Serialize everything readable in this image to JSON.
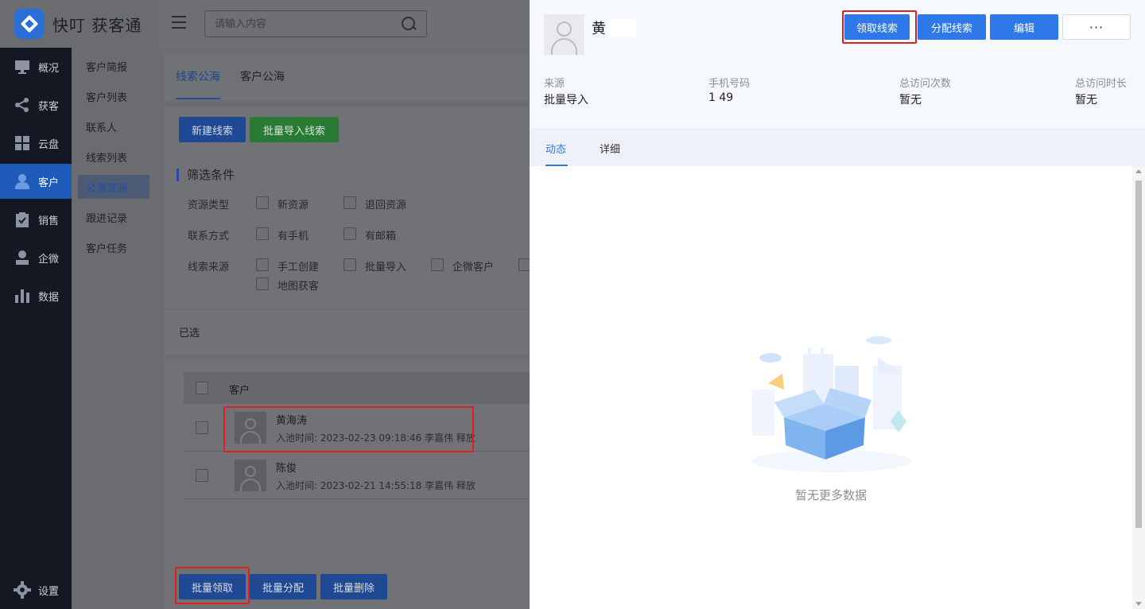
{
  "app": {
    "name": "快叮 获客通",
    "brand_color": "#2e78ea",
    "search": {
      "placeholder": "请输入内容"
    }
  },
  "nav": {
    "items": [
      {
        "label": "概况",
        "icon": "monitor-icon"
      },
      {
        "label": "获客",
        "icon": "share-icon"
      },
      {
        "label": "云盘",
        "icon": "grid-icon"
      },
      {
        "label": "客户",
        "icon": "user-icon",
        "active": true
      },
      {
        "label": "销售",
        "icon": "clipboard-check-icon"
      },
      {
        "label": "企微",
        "icon": "person-icon"
      },
      {
        "label": "数据",
        "icon": "bar-chart-icon"
      }
    ],
    "settings": {
      "label": "设置",
      "icon": "gear-icon"
    }
  },
  "submenu": {
    "items": [
      "客户简报",
      "客户列表",
      "联系人",
      "线索列表",
      "公海资源",
      "跟进记录",
      "客户任务"
    ],
    "active_index": 4
  },
  "main": {
    "tabs": [
      "线索公海",
      "客户公海"
    ],
    "toolbar": {
      "new_lead": "新建线索",
      "batch_import": "批量导入线索"
    },
    "filters": {
      "title": "筛选条件",
      "rows": [
        {
          "label": "资源类型",
          "options": [
            "新资源",
            "退回资源"
          ]
        },
        {
          "label": "联系方式",
          "options": [
            "有手机",
            "有邮箱"
          ]
        },
        {
          "label": "线索来源",
          "options": [
            "手工创建",
            "批量导入",
            "企微客户",
            "地图获客"
          ]
        }
      ]
    },
    "selected_label": "已选",
    "table": {
      "header": "客户",
      "rows": [
        {
          "name": "黄海涛",
          "meta": "入池时间: 2023-02-23 09:18:46 李嘉伟 释放"
        },
        {
          "name": "陈俊",
          "meta": "入池时间: 2023-02-21 14:55:18 李嘉伟 释放"
        }
      ]
    },
    "bulk_actions": {
      "claim": "批量领取",
      "assign": "批量分配",
      "delete": "批量删除"
    }
  },
  "drawer": {
    "name": "黄",
    "actions": {
      "claim": "领取线索",
      "assign": "分配线索",
      "edit": "编辑",
      "more": "···"
    },
    "info": [
      {
        "label": "来源",
        "value": "批量导入"
      },
      {
        "label": "手机号码",
        "value": "1          49"
      },
      {
        "label": "总访问次数",
        "value": "暂无"
      },
      {
        "label": "总访问时长",
        "value": "暂无"
      }
    ],
    "tabs": [
      "动态",
      "详细"
    ],
    "empty_text": "暂无更多数据"
  }
}
